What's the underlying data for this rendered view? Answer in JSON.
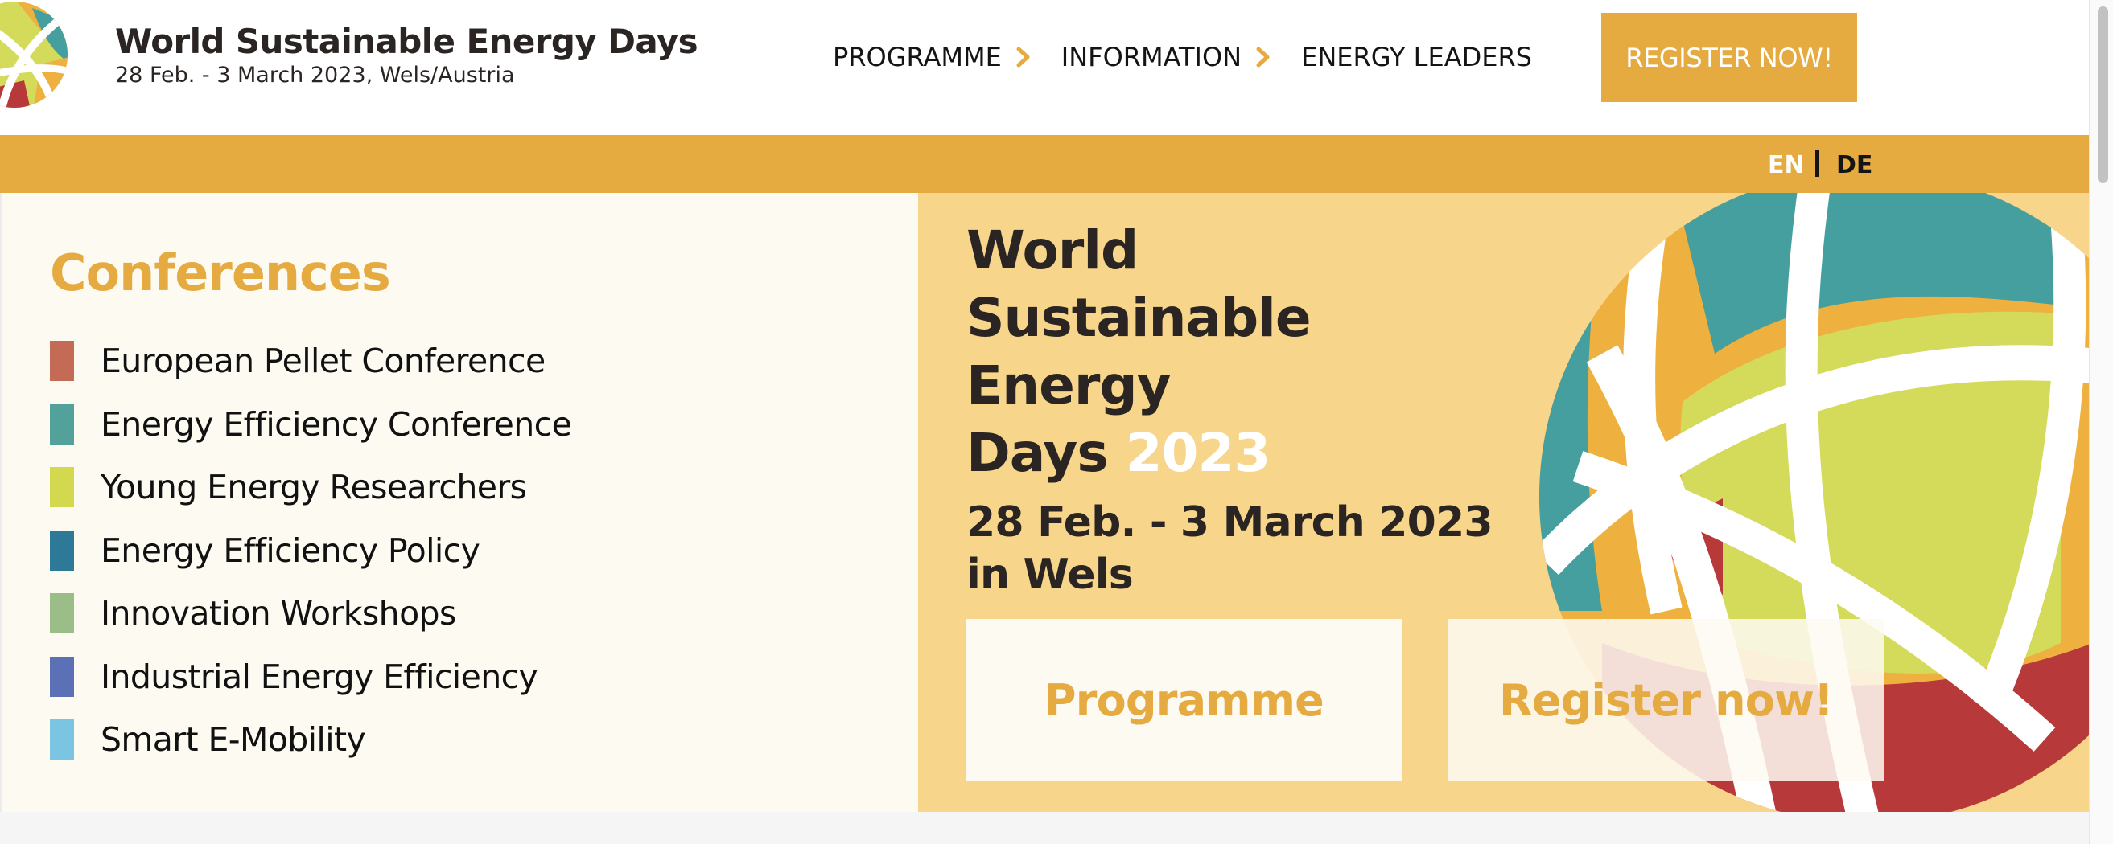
{
  "header": {
    "title": "World Sustainable Energy Days",
    "subtitle": "28 Feb. - 3 March 2023, Wels/Austria",
    "nav": [
      {
        "label": "PROGRAMME",
        "has_chevron": true
      },
      {
        "label": "INFORMATION",
        "has_chevron": true
      },
      {
        "label": "ENERGY LEADERS",
        "has_chevron": false
      }
    ],
    "register_label": "REGISTER NOW!"
  },
  "languages": {
    "active": "EN",
    "other": "DE"
  },
  "conferences": {
    "heading": "Conferences",
    "items": [
      {
        "label": "European Pellet Conference",
        "color": "#c46b56"
      },
      {
        "label": "Energy Efficiency Conference",
        "color": "#52a19b"
      },
      {
        "label": "Young Energy Researchers",
        "color": "#d3d94e"
      },
      {
        "label": "Energy Efficiency Policy",
        "color": "#2f7998"
      },
      {
        "label": "Innovation Workshops",
        "color": "#9bbd88"
      },
      {
        "label": "Industrial Energy Efficiency",
        "color": "#5c70b5"
      },
      {
        "label": "Smart E-Mobility",
        "color": "#7bc4e2"
      }
    ]
  },
  "hero": {
    "title_lines": [
      "World",
      "Sustainable",
      "Energy",
      "Days"
    ],
    "title_year": "2023",
    "dates_line1": "28 Feb. - 3 March 2023",
    "dates_line2": "in Wels",
    "programme_button": "Programme",
    "register_button": "Register now!"
  },
  "colors": {
    "accent": "#e5ab41",
    "hero_bg": "#f7d58b",
    "panel_bg": "#fdfaf2",
    "globe_teal": "#469f9f",
    "globe_orange": "#eeb03f",
    "globe_green": "#d4db5a",
    "globe_red": "#b8393a"
  }
}
